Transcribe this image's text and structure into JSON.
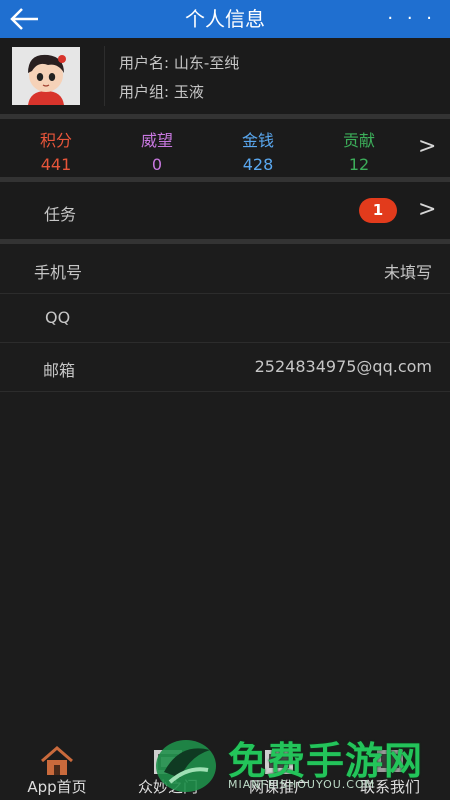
{
  "header": {
    "title": "个人信息",
    "more": "· · ·"
  },
  "profile": {
    "username": "用户名: 山东-至纯",
    "group": "用户组: 玉液"
  },
  "stats": [
    {
      "label": "积分",
      "value": "441",
      "color": "#e8553a"
    },
    {
      "label": "威望",
      "value": "0",
      "color": "#c878e0"
    },
    {
      "label": "金钱",
      "value": "428",
      "color": "#5aa8f0"
    },
    {
      "label": "贡献",
      "value": "12",
      "color": "#3cae5a"
    }
  ],
  "chevron": ">",
  "task": {
    "label": "任务",
    "badge": "1"
  },
  "info_rows": [
    {
      "label": "手机号",
      "value": "未填写"
    },
    {
      "label": "QQ",
      "value": ""
    },
    {
      "label": "邮箱",
      "value": "2524834975@qq.com"
    }
  ],
  "bottom_nav": [
    {
      "label": "App首页",
      "icon": "home-icon"
    },
    {
      "label": "众妙之门",
      "icon": "gate-icon"
    },
    {
      "label": "网课推广",
      "icon": "course-icon"
    },
    {
      "label": "联系我们",
      "icon": "contact-icon"
    }
  ],
  "watermark": {
    "text": "免费手游网",
    "sub": "MIANFEISHOUYOU.COM"
  }
}
